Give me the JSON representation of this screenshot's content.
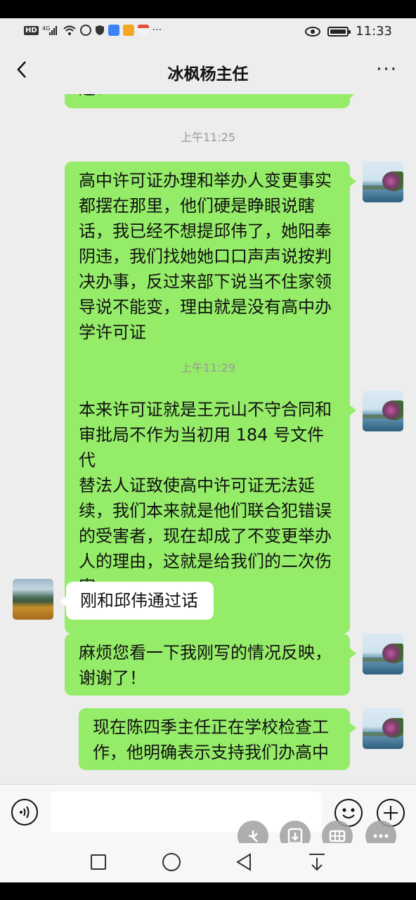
{
  "status_bar": {
    "left_icons": [
      "hd-icon",
      "4g-signal-icon",
      "wifi-icon",
      "app-icon",
      "shield-icon",
      "search-app-icon",
      "mail-app-icon",
      "notification-icon"
    ],
    "more": "···",
    "time": "11:33"
  },
  "header": {
    "title": "冰枫杨主任",
    "more": "···"
  },
  "messages": {
    "partial_top": "违？",
    "time1": "上午11:25",
    "m1": [
      "高中许可证办理和举办人变更事实",
      "都摆在那里，他们硬是睁眼说瞎",
      "话，我已经不想提邱伟了，她阳奉",
      "阴违，我们找她她口口声声说按判",
      "决办事，反过来部下说当不住家领",
      "导说不能变，理由就是没有高中办",
      "学许可证"
    ],
    "time2": "上午11:29",
    "m2": [
      "本来许可证就是王元山不守合同和",
      "审批局不作为当初用 184 号文件代",
      "替法人证致使高中许可证无法延",
      "续，我们本来就是他们联合犯错误",
      "的受害者，现在却成了不变更举办",
      "人的理由，这就是给我们的二次伤",
      "害"
    ],
    "m3": "刚和邱伟通过话",
    "m4": [
      "麻烦您看一下我刚写的情况反映，",
      "谢谢了！"
    ],
    "m5": [
      "现在陈四季主任正在学校检查工",
      "作，他明确表示支持我们办高中"
    ]
  },
  "input": {
    "placeholder": ""
  },
  "colors": {
    "my_bubble": "#95ec69",
    "their_bubble": "#ffffff",
    "background": "#ededed"
  }
}
